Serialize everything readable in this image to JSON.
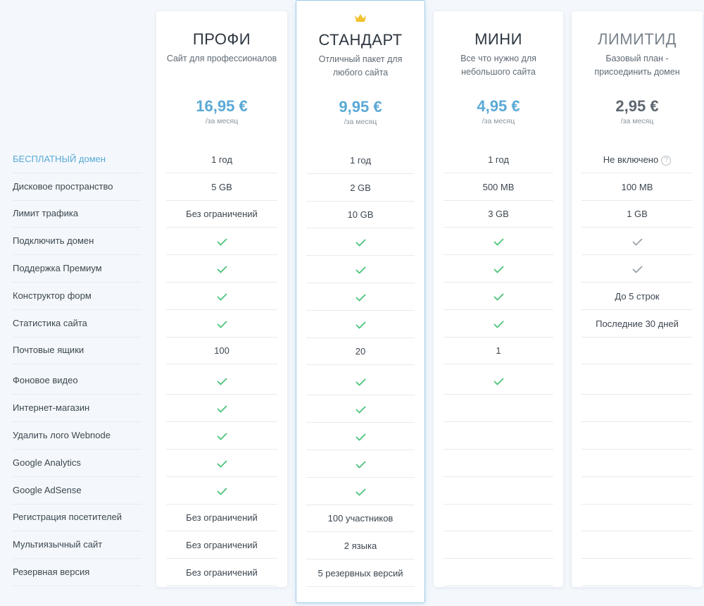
{
  "features": [
    "БЕСПЛАТНЫЙ домен",
    "Дисковое пространство",
    "Лимит трафика",
    "Подключить домен",
    "Поддержка Премиум",
    "Конструктор форм",
    "Статистика сайта",
    "Почтовые ящики",
    "Фоновое видео",
    "Интернет-магазин",
    "Удалить лого Webnode",
    "Google Analytics",
    "Google AdSense",
    "Регистрация посетителей",
    "Мультиязычный сайт",
    "Резервная версия"
  ],
  "plans": [
    {
      "name": "ПРОФИ",
      "description": "Сайт для профессионалов",
      "price": "16,95 €",
      "period": "/за месяц",
      "values": [
        "1 год",
        "5 GB",
        "Без ограничений",
        "check",
        "check",
        "check",
        "check",
        "100",
        "check",
        "check",
        "check",
        "check",
        "check",
        "Без ограничений",
        "Без ограничений",
        "Без ограничений"
      ]
    },
    {
      "name": "СТАНДАРТ",
      "description": "Отличный пакет для любого сайта",
      "price": "9,95 €",
      "period": "/за месяц",
      "badge_icon": "crown-icon",
      "values": [
        "1 год",
        "2 GB",
        "10 GB",
        "check",
        "check",
        "check",
        "check",
        "20",
        "check",
        "check",
        "check",
        "check",
        "check",
        "100 участников",
        "2 языка",
        "5 резервных версий"
      ]
    },
    {
      "name": "МИНИ",
      "description": "Все что нужно для небольшого сайта",
      "price": "4,95 €",
      "period": "/за месяц",
      "values": [
        "1 год",
        "500 MB",
        "3 GB",
        "check",
        "check",
        "check",
        "check",
        "1",
        "check",
        "",
        "",
        "",
        "",
        "",
        "",
        ""
      ]
    },
    {
      "name": "ЛИМИТИД",
      "description": "Базовый план - присоединить домен",
      "price": "2,95 €",
      "period": "/за месяц",
      "values": [
        "Не включено",
        "100 MB",
        "1 GB",
        "check-gray",
        "check-gray",
        "До 5 строк",
        "Последние 30 дней",
        "",
        "",
        "",
        "",
        "",
        "",
        "",
        "",
        ""
      ]
    }
  ],
  "colors": {
    "accent": "#5aa9d6",
    "check": "#4cc37a",
    "check_gray": "#9aa3aa",
    "crown": "#f2c230"
  }
}
